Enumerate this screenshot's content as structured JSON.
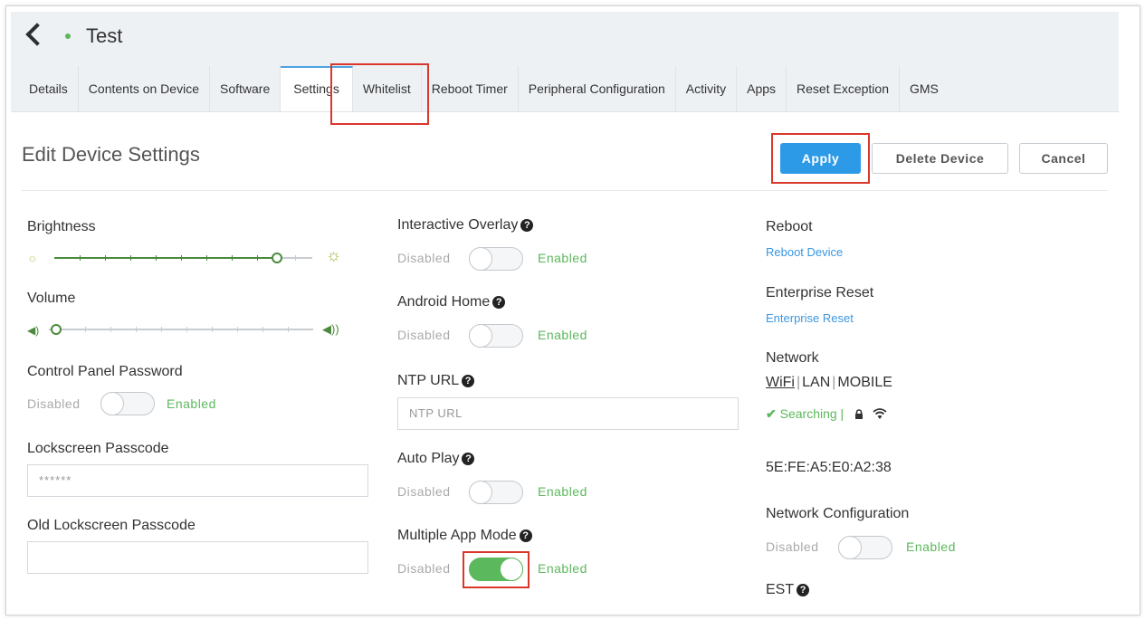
{
  "header": {
    "title": "Test"
  },
  "tabs": [
    {
      "label": "Details"
    },
    {
      "label": "Contents on Device"
    },
    {
      "label": "Software"
    },
    {
      "label": "Settings"
    },
    {
      "label": "Whitelist"
    },
    {
      "label": "Reboot Timer"
    },
    {
      "label": "Peripheral Configuration"
    },
    {
      "label": "Activity"
    },
    {
      "label": "Apps"
    },
    {
      "label": "Reset Exception"
    },
    {
      "label": "GMS"
    }
  ],
  "active_tab": "Settings",
  "section": {
    "title": "Edit Device Settings"
  },
  "actions": {
    "apply": "Apply",
    "delete": "Delete Device",
    "cancel": "Cancel"
  },
  "left": {
    "brightness": {
      "label": "Brightness",
      "value_fraction": 0.86
    },
    "volume": {
      "label": "Volume",
      "value_fraction": 0.0
    },
    "control_panel": {
      "label": "Control Panel Password",
      "off": "Disabled",
      "on": "Enabled",
      "enabled": false
    },
    "lockscreen": {
      "label": "Lockscreen Passcode",
      "value": "******"
    },
    "old_lockscreen": {
      "label": "Old Lockscreen Passcode",
      "value": ""
    }
  },
  "middle": {
    "interactive_overlay": {
      "label": "Interactive Overlay",
      "off": "Disabled",
      "on": "Enabled",
      "enabled": false
    },
    "android_home": {
      "label": "Android Home",
      "off": "Disabled",
      "on": "Enabled",
      "enabled": false
    },
    "ntp": {
      "label": "NTP URL",
      "placeholder": "NTP URL"
    },
    "auto_play": {
      "label": "Auto Play",
      "off": "Disabled",
      "on": "Enabled",
      "enabled": false
    },
    "multiple_app": {
      "label": "Multiple App Mode",
      "off": "Disabled",
      "on": "Enabled",
      "enabled": true
    }
  },
  "right": {
    "reboot": {
      "label": "Reboot",
      "link": "Reboot Device"
    },
    "enterprise": {
      "label": "Enterprise Reset",
      "link": "Enterprise Reset"
    },
    "network": {
      "label": "Network",
      "wifi": "WiFi",
      "lan": "LAN",
      "mobile": "MOBILE",
      "sep": "|",
      "status": "Searching |"
    },
    "mac": "5E:FE:A5:E0:A2:38",
    "net_config": {
      "label": "Network Configuration",
      "off": "Disabled",
      "on": "Enabled",
      "enabled": false
    },
    "est": {
      "label": "EST"
    }
  },
  "help_glyph": "?",
  "colors": {
    "accent": "#2d9ae8",
    "success": "#5cb85c",
    "highlight": "#d9372b"
  }
}
